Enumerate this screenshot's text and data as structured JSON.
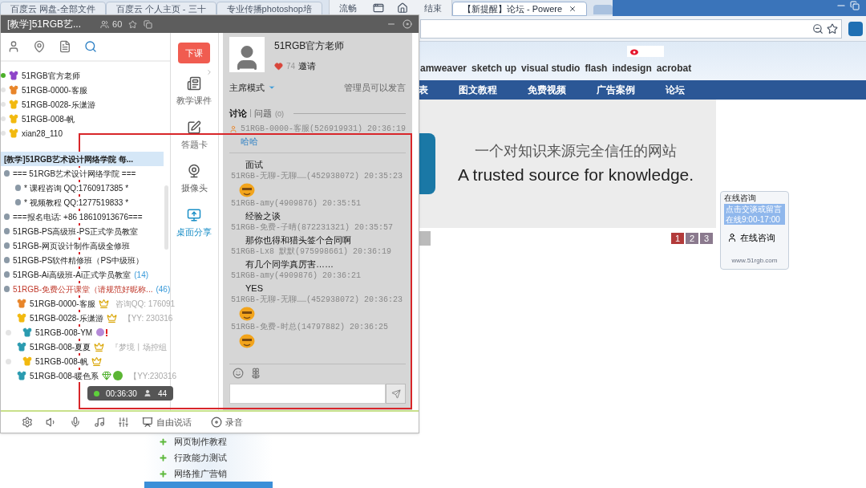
{
  "browser": {
    "tabs": [
      {
        "title": "百度云 网盘-全部文件",
        "selected": false
      },
      {
        "title": "百度云 个人主页 - 三十",
        "selected": false
      },
      {
        "title": "专业传播photoshop培",
        "selected": false
      },
      {
        "title": "【新提醒】论坛 - Powere",
        "selected": true
      }
    ],
    "share_toolbar": {
      "quality": "流畅",
      "stop": "结束"
    },
    "site": {
      "software": [
        "amweaver",
        "sketch up",
        "visual studio",
        "flash",
        "indesign",
        "acrobat"
      ],
      "nav": [
        "表",
        "图文教程",
        "免费视频",
        "广告案例",
        "论坛"
      ],
      "banner": {
        "slogan_cn": "一个对知识来源完全信任的网站",
        "slogan_en": "A trusted source for knowledge."
      },
      "pages": [
        {
          "label": "1",
          "selected": true
        },
        {
          "label": "2",
          "selected": false
        },
        {
          "label": "3",
          "selected": false
        }
      ],
      "consult": {
        "title": "在线咨询",
        "notice": "点击交谈或留言",
        "hours": "在线9:00-17:00",
        "button": "在线咨询",
        "url": "www.51rgb.com"
      },
      "side_menu": [
        "网页制作教程",
        "行政能力测试",
        "网络推广营销"
      ]
    }
  },
  "yy": {
    "title": "[教学]51RGB艺...",
    "online_count": "60",
    "members": [
      {
        "name": "51RGB官方老师",
        "color": "#8e44c9",
        "online": true
      },
      {
        "name": "51RGB-0000-客服",
        "color": "#e8852a",
        "online": false
      },
      {
        "name": "51RGB-0028-乐潇游",
        "color": "#f2b90f",
        "online": false
      },
      {
        "name": "51RGB-008-帆",
        "color": "#f2b90f",
        "online": false
      },
      {
        "name": "xian28_110",
        "color": "#f2b90f",
        "online": false
      }
    ],
    "group": {
      "text": "[教学]51RGB艺术设计网络学院 每...",
      "selected": true,
      "children": [
        {
          "text": "=== 51RGB艺术设计网络学院 ===",
          "current": false,
          "children": [
            {
              "text": "* 课程咨询 QQ:1760917385 *",
              "current": false
            },
            {
              "text": "* 视频教程 QQ:1277519833 *",
              "current": false
            }
          ]
        },
        {
          "text": "===报名电话: +86 18610913676===",
          "current": false
        },
        {
          "text": "51RGB-PS高级班-PS正式学员教室",
          "current": false
        },
        {
          "text": "51RGB-网页设计制作高级全修班",
          "current": false
        },
        {
          "text": "51RGB-PS软件精修班（PS中级班）",
          "current": false
        },
        {
          "text": "51RGB-Ai高级班-Ai正式学员教室",
          "count": "(14)",
          "current": false
        },
        {
          "text": "51RGB-免费公开课堂（请规范好昵称...",
          "count": "(46)",
          "current": true,
          "users": [
            {
              "name": "51RGB-0000-客服",
              "color": "#e8852a",
              "kind": "crown",
              "note": "咨询QQ: 176091"
            },
            {
              "name": "51RGB-0028-乐潇游",
              "color": "#f2b90f",
              "kind": "crown",
              "note": "【YY: 230316"
            },
            {
              "name": "51RGB-008-YM",
              "color": "#2a9bb0",
              "kind": "medal"
            },
            {
              "name": "51RGB-008-夏夏",
              "color": "#2a9bb0",
              "kind": "crown",
              "note": "『梦境丨场控组"
            },
            {
              "name": "51RGB-008-帆",
              "color": "#f2b90f",
              "kind": "crown"
            },
            {
              "name": "51RGB-008-暖色系",
              "color": "#2a9bb0",
              "kind": "diamond",
              "note": "【YY:230316"
            }
          ]
        }
      ]
    },
    "tools": [
      {
        "kind": "end-class",
        "label": "下课",
        "selected": false
      },
      {
        "kind": "courseware",
        "label": "教学课件",
        "selected": false
      },
      {
        "kind": "answer-card",
        "label": "答题卡",
        "selected": false
      },
      {
        "kind": "camera",
        "label": "摄像头",
        "selected": false
      },
      {
        "kind": "screen-share",
        "label": "桌面分享",
        "selected": true
      }
    ],
    "host": {
      "name": "51RGB官方老师",
      "likes": "74",
      "invite": "邀请",
      "mode": "主席模式",
      "speak_rule": "管理员可以发言"
    },
    "chat_tabs": [
      {
        "label": "讨论",
        "selected": true
      },
      {
        "label": "问题",
        "count": "(0)",
        "selected": false
      }
    ],
    "messages": [
      {
        "kind": "sender",
        "text": "51RGB-0000-客服(526919931) 20:36:19"
      },
      {
        "kind": "highlight",
        "text": "哈哈"
      },
      {
        "kind": "divider"
      },
      {
        "kind": "text",
        "text": "面试"
      },
      {
        "kind": "sender",
        "text": "51RGB-无聊-无聊……(452938072) 20:35:23"
      },
      {
        "kind": "emoji"
      },
      {
        "kind": "sender",
        "text": "51RGB-amy(4909876) 20:35:51"
      },
      {
        "kind": "text",
        "text": "经验之谈"
      },
      {
        "kind": "sender",
        "text": "51RGB-免费-子晴(872231321) 20:35:57"
      },
      {
        "kind": "text",
        "text": "那你也得和猎头签个合同啊"
      },
      {
        "kind": "sender",
        "text": "51RGB-Lx8 默默(975998661) 20:36:19"
      },
      {
        "kind": "text",
        "text": "有几个同学真厉害……"
      },
      {
        "kind": "sender",
        "text": "51RGB-amy(4909876) 20:36:21"
      },
      {
        "kind": "text",
        "text": "YES"
      },
      {
        "kind": "sender",
        "text": "51RGB-无聊-无聊……(452938072) 20:36:23"
      },
      {
        "kind": "emoji"
      },
      {
        "kind": "sender",
        "text": "51RGB-免费-时总(14797882) 20:36:25"
      },
      {
        "kind": "emoji"
      }
    ],
    "timer": {
      "time": "00:36:30",
      "viewers": "44"
    },
    "toolbar": {
      "free_talk": "自由说话",
      "record": "录音"
    }
  }
}
